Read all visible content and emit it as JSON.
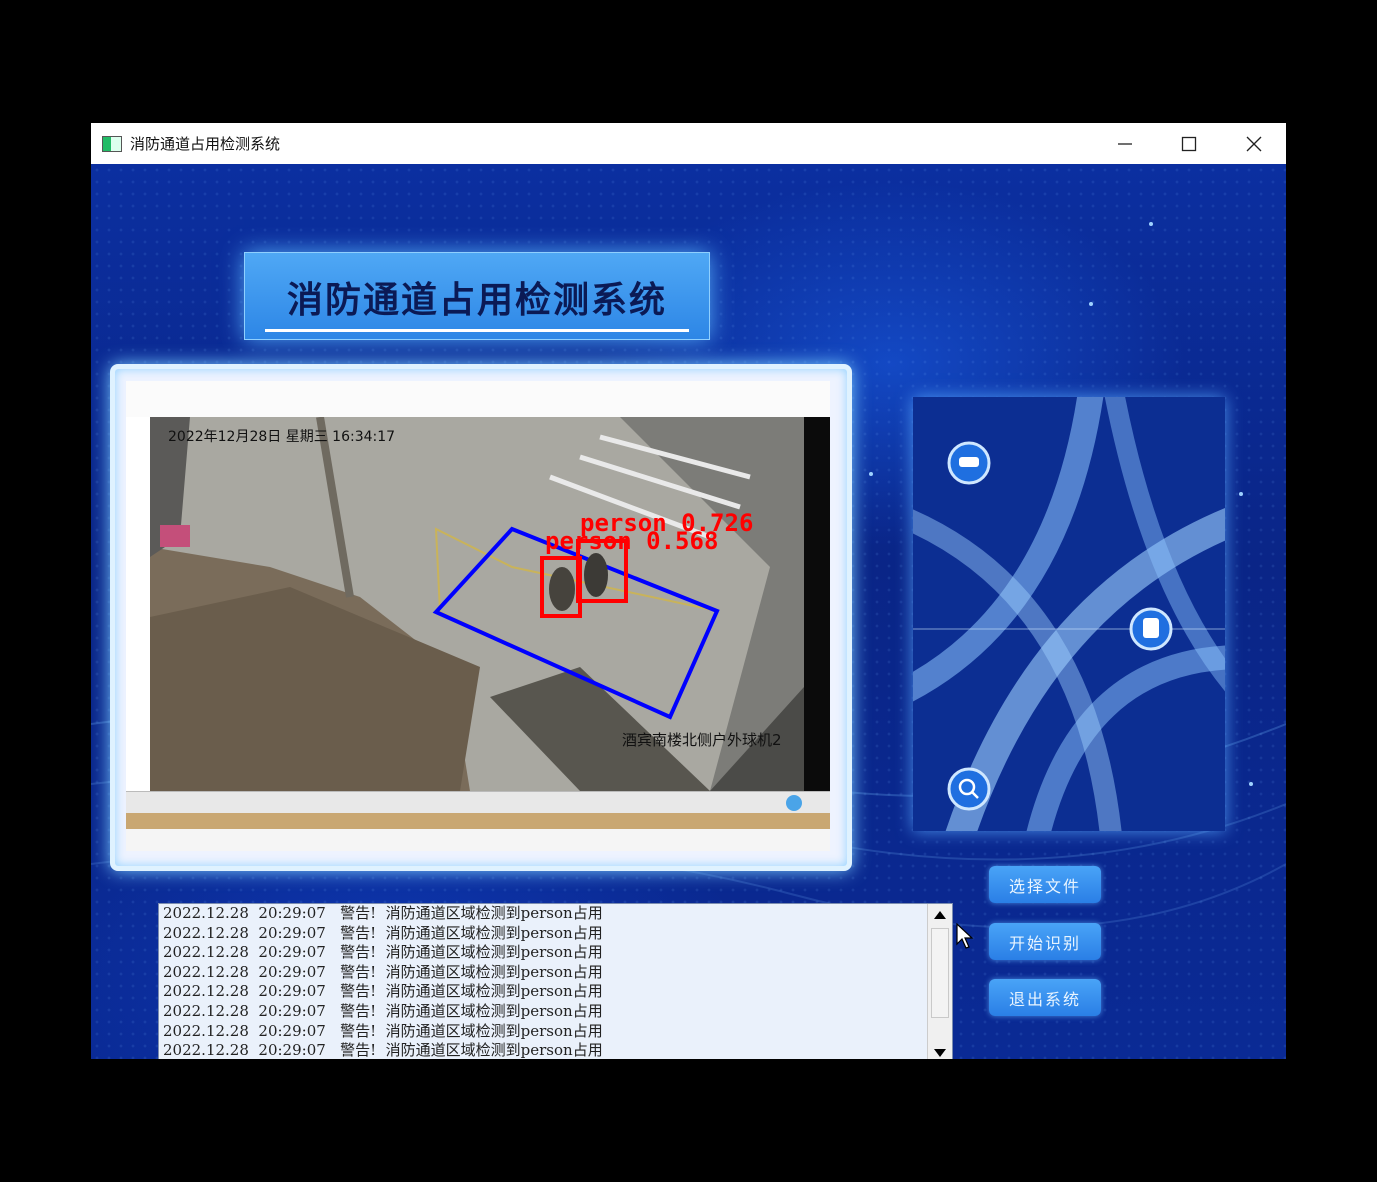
{
  "window": {
    "title": "消防通道占用检测系统"
  },
  "banner": {
    "title": "消防通道占用检测系统"
  },
  "video": {
    "osd_datetime": "2022年12月28日  星期三  16:34:17",
    "camera_label": "酒宾南楼北侧户外球机2",
    "detections": [
      {
        "label": "person",
        "score": "0.726"
      },
      {
        "label": "person",
        "score": "0.568"
      }
    ]
  },
  "log": {
    "lines": [
      "2022.12.28  20:29:07   警告!  消防通道区域检测到person占用",
      "2022.12.28  20:29:07   警告!  消防通道区域检测到person占用",
      "2022.12.28  20:29:07   警告!  消防通道区域检测到person占用",
      "2022.12.28  20:29:07   警告!  消防通道区域检测到person占用",
      "2022.12.28  20:29:07   警告!  消防通道区域检测到person占用",
      "2022.12.28  20:29:07   警告!  消防通道区域检测到person占用",
      "2022.12.28  20:29:07   警告!  消防通道区域检测到person占用",
      "2022.12.28  20:29:07   警告!  消防通道区域检测到person占用"
    ]
  },
  "buttons": {
    "select_file": "选择文件",
    "start_detect": "开始识别",
    "exit": "退出系统"
  },
  "colors": {
    "accent": "#2d86e6",
    "background": "#0a2a8c",
    "detection_box": "#ff0000",
    "region_box": "#0000ff"
  }
}
